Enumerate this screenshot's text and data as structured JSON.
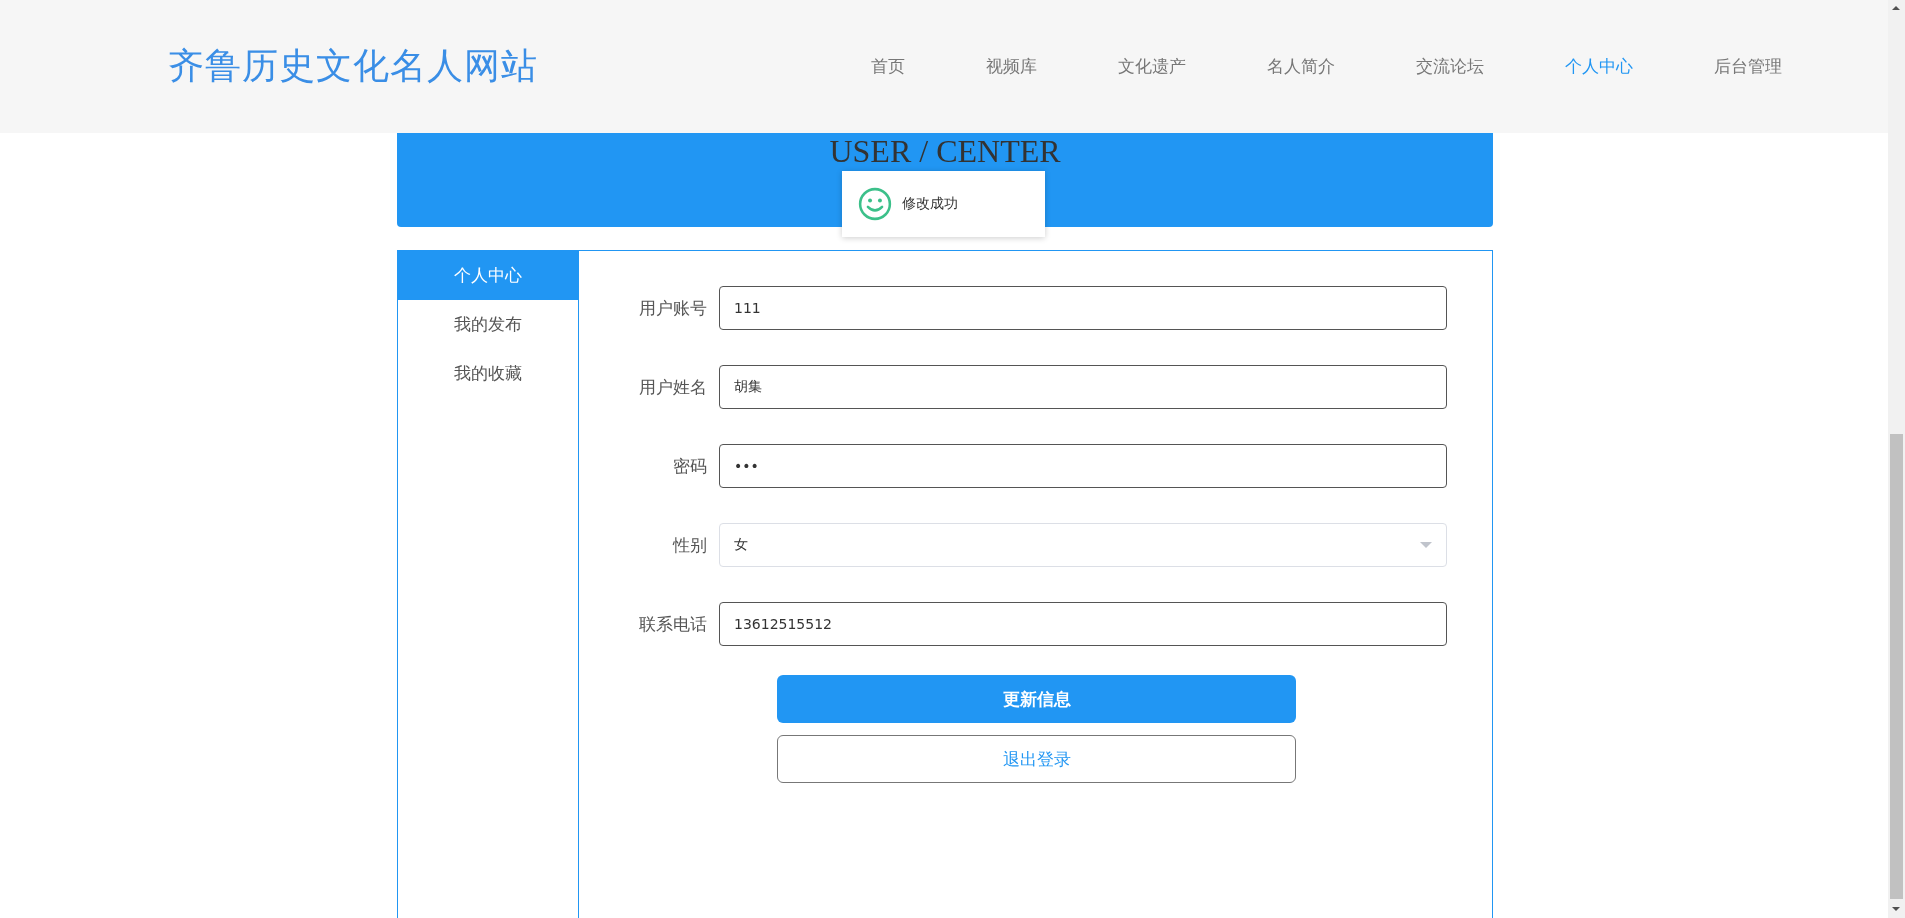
{
  "header": {
    "logo": "齐鲁历史文化名人网站",
    "nav": [
      {
        "label": "首页",
        "selected": false
      },
      {
        "label": "视频库",
        "selected": false
      },
      {
        "label": "文化遗产",
        "selected": false
      },
      {
        "label": "名人简介",
        "selected": false
      },
      {
        "label": "交流论坛",
        "selected": false
      },
      {
        "label": "个人中心",
        "selected": true
      },
      {
        "label": "后台管理",
        "selected": false
      }
    ]
  },
  "banner": {
    "title": "USER / CENTER"
  },
  "toast": {
    "message": "修改成功"
  },
  "sidebar": {
    "items": [
      {
        "label": "个人中心",
        "selected": true
      },
      {
        "label": "我的发布",
        "selected": false
      },
      {
        "label": "我的收藏",
        "selected": false
      }
    ]
  },
  "form": {
    "fields": [
      {
        "label": "用户账号",
        "kind": "text",
        "value": "111"
      },
      {
        "label": "用户姓名",
        "kind": "text",
        "value": "胡集"
      },
      {
        "label": "密码",
        "kind": "text",
        "value": "•••"
      },
      {
        "label": "性别",
        "kind": "select",
        "value": "女"
      },
      {
        "label": "联系电话",
        "kind": "text",
        "value": "13612515512"
      }
    ],
    "buttons": [
      {
        "label": "更新信息",
        "kind": "primary"
      },
      {
        "label": "退出登录",
        "kind": "plain"
      }
    ]
  }
}
